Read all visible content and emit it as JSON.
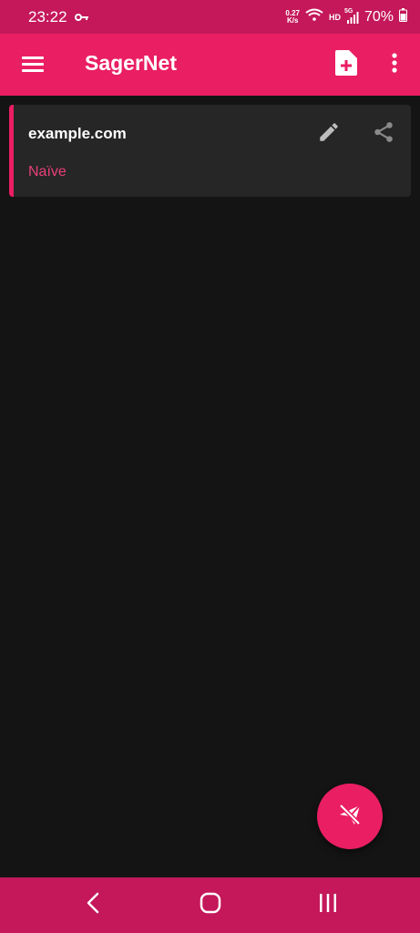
{
  "status_bar": {
    "time": "23:22",
    "net_speed_value": "0.27",
    "net_speed_unit": "K/s",
    "hd": "HD",
    "network_type": "5G",
    "battery": "70%"
  },
  "app_bar": {
    "title": "SagerNet"
  },
  "profiles": [
    {
      "name": "example.com",
      "type": "Naïve"
    }
  ],
  "colors": {
    "accent": "#ea1e63",
    "status_bar": "#c4185a",
    "background": "#141414",
    "card": "#262626"
  },
  "icons": {
    "menu": "hamburger-menu-icon",
    "new_profile": "note-add-icon",
    "overflow": "more-vert-icon",
    "edit": "pencil-icon",
    "share": "share-icon",
    "connect": "paper-plane-off-icon"
  }
}
